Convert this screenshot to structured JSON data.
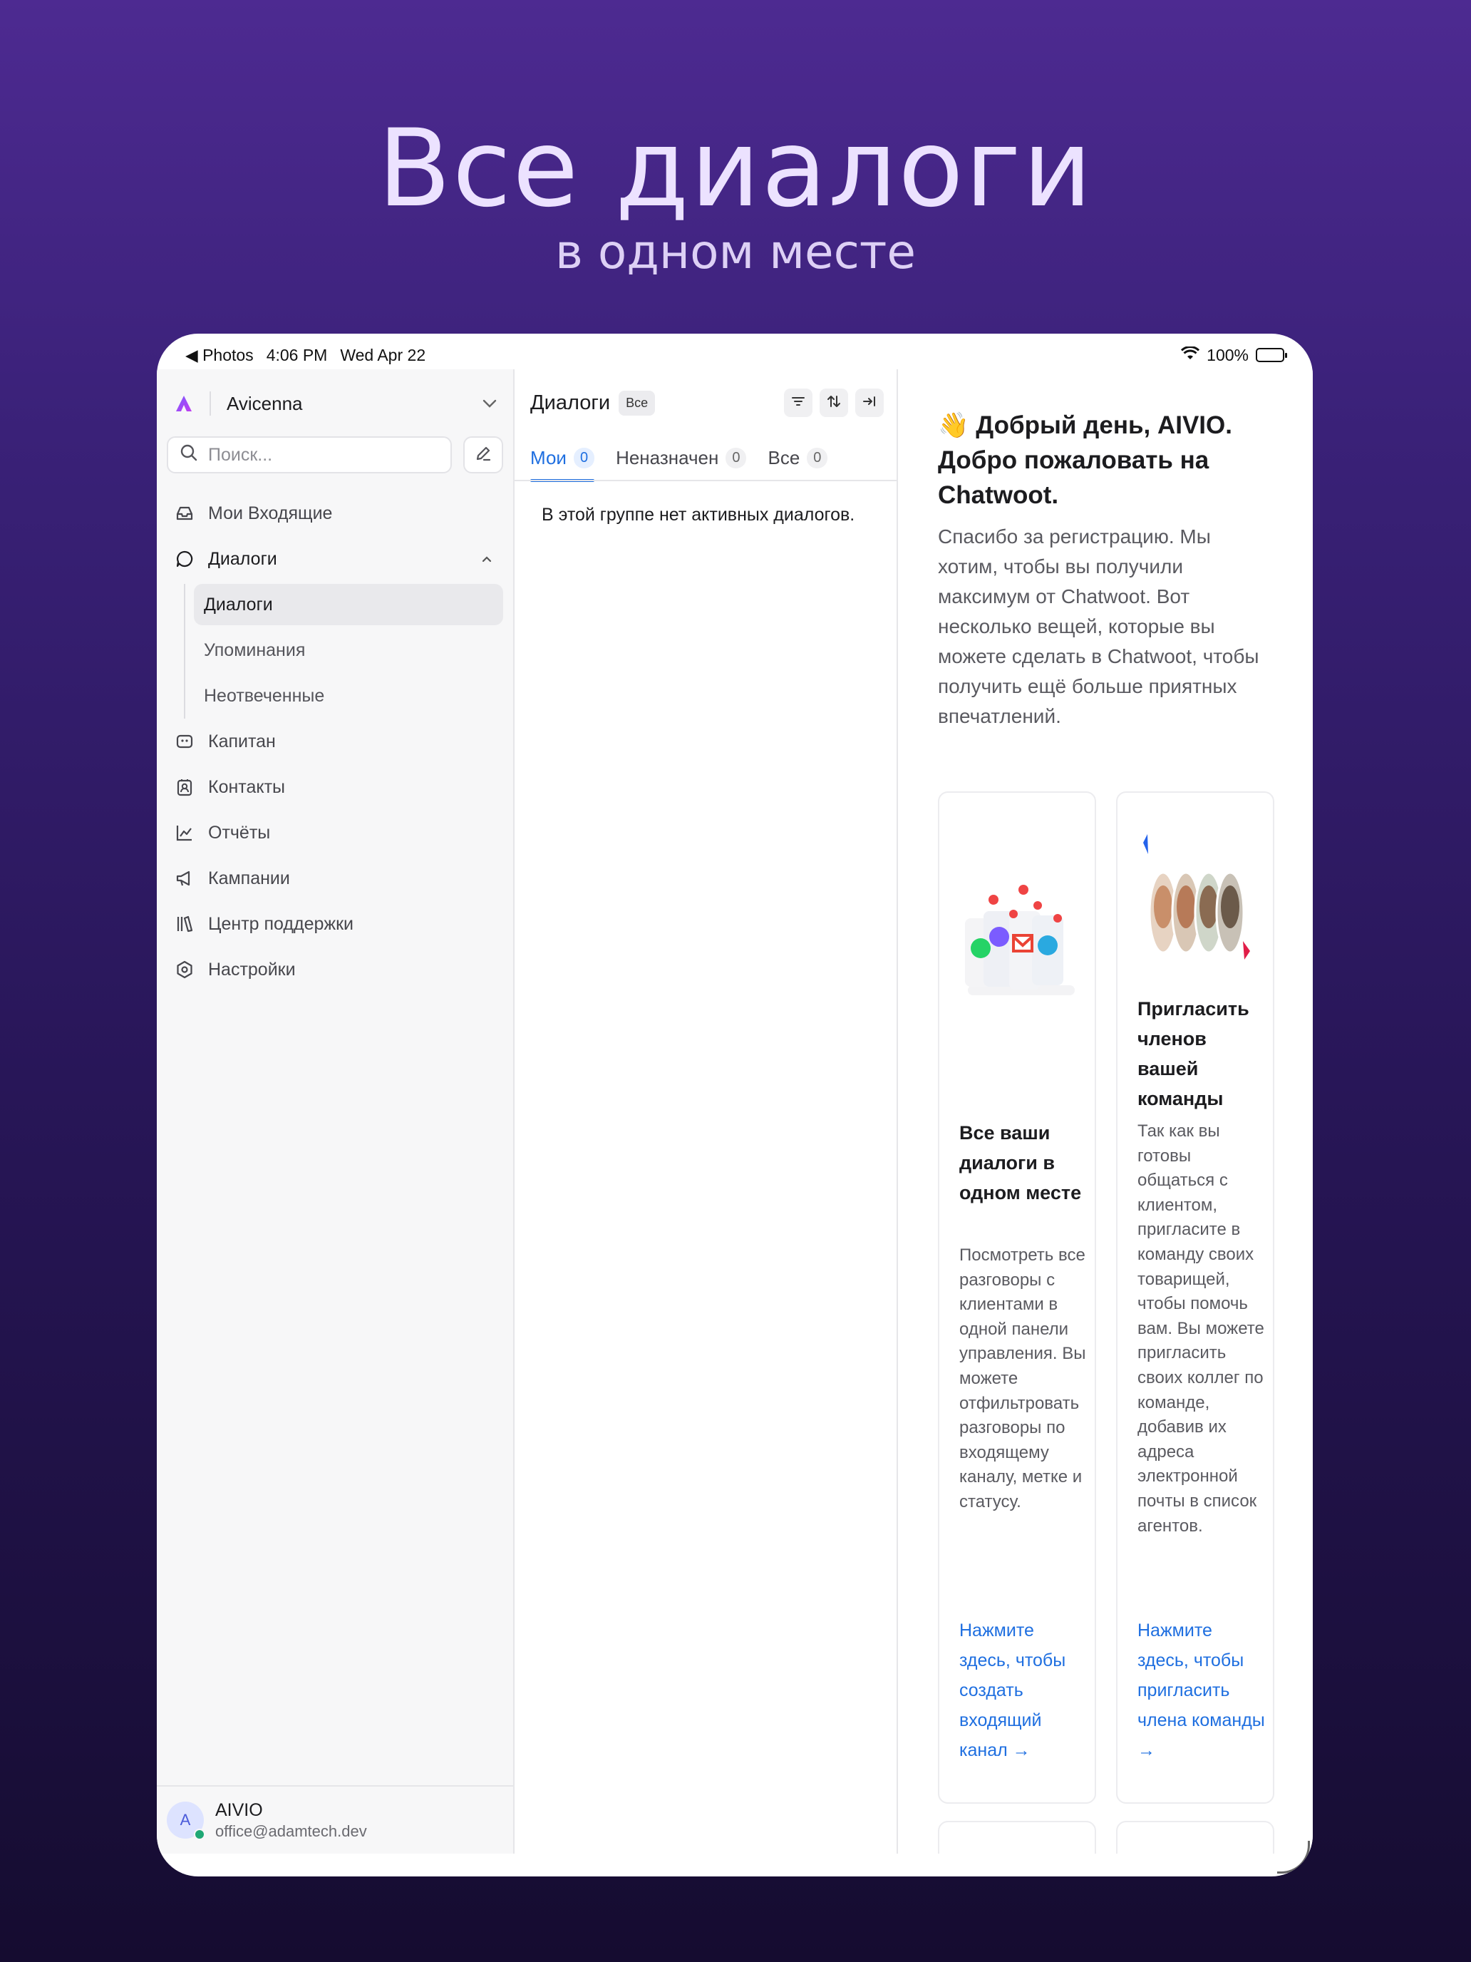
{
  "promo": {
    "title": "Все диалоги",
    "subtitle": "в одном месте"
  },
  "statusbar": {
    "back_app": "◀ Photos",
    "time": "4:06 PM",
    "date": "Wed Apr 22",
    "battery": "100%"
  },
  "sidebar": {
    "brand": "Avicenna",
    "search_placeholder": "Поиск...",
    "items": [
      {
        "label": "Мои Входящие",
        "icon": "inbox-icon"
      },
      {
        "label": "Диалоги",
        "icon": "chat-bubble-icon"
      },
      {
        "label": "Капитан",
        "icon": "captain-bot-icon"
      },
      {
        "label": "Контакты",
        "icon": "contacts-icon"
      },
      {
        "label": "Отчёты",
        "icon": "chart-line-icon"
      },
      {
        "label": "Кампании",
        "icon": "megaphone-icon"
      },
      {
        "label": "Центр поддержки",
        "icon": "library-icon"
      },
      {
        "label": "Настройки",
        "icon": "settings-hex-icon"
      }
    ],
    "subitems": [
      "Диалоги",
      "Упоминания",
      "Неотвеченные"
    ],
    "user": {
      "initial": "A",
      "name": "AIVIO",
      "email": "office@adamtech.dev"
    }
  },
  "list": {
    "title": "Диалоги",
    "filter_badge": "Все",
    "tabs": [
      {
        "label": "Мои",
        "count": "0"
      },
      {
        "label": "Неназначен",
        "count": "0"
      },
      {
        "label": "Все",
        "count": "0"
      }
    ],
    "empty": "В этой группе нет активных диалогов."
  },
  "welcome": {
    "title": "👋 Добрый день, AIVIO. Добро пожаловать на Chatwoot.",
    "text": "Спасибо за регистрацию. Мы хотим, чтобы вы получили максимум от Chatwoot. Вот несколько вещей, которые вы можете сделать в Chatwoot, чтобы получить ещё больше приятных впечатлений.",
    "cards": [
      {
        "title": "Все ваши диалоги в одном месте",
        "text": "Посмотреть все разговоры с клиентами в одной панели управления. Вы можете отфильтровать разговоры по входящему каналу, метке и статусу.",
        "link": "Нажмите здесь, чтобы создать входящий канал →"
      },
      {
        "title": "Пригласить членов вашей команды",
        "text": "Так как вы готовы общаться с клиентом, пригласите в команду своих товарищей, чтобы помочь вам. Вы можете пригласить своих коллег по команде, добавив их адреса электронной почты в список агентов.",
        "link": "Нажмите здесь, чтобы пригласить члена команды →"
      }
    ]
  },
  "colors": {
    "accent": "#1f6fe0",
    "online": "#1fa875",
    "bg_top": "#4d2a91",
    "bg_bottom": "#150c30"
  }
}
